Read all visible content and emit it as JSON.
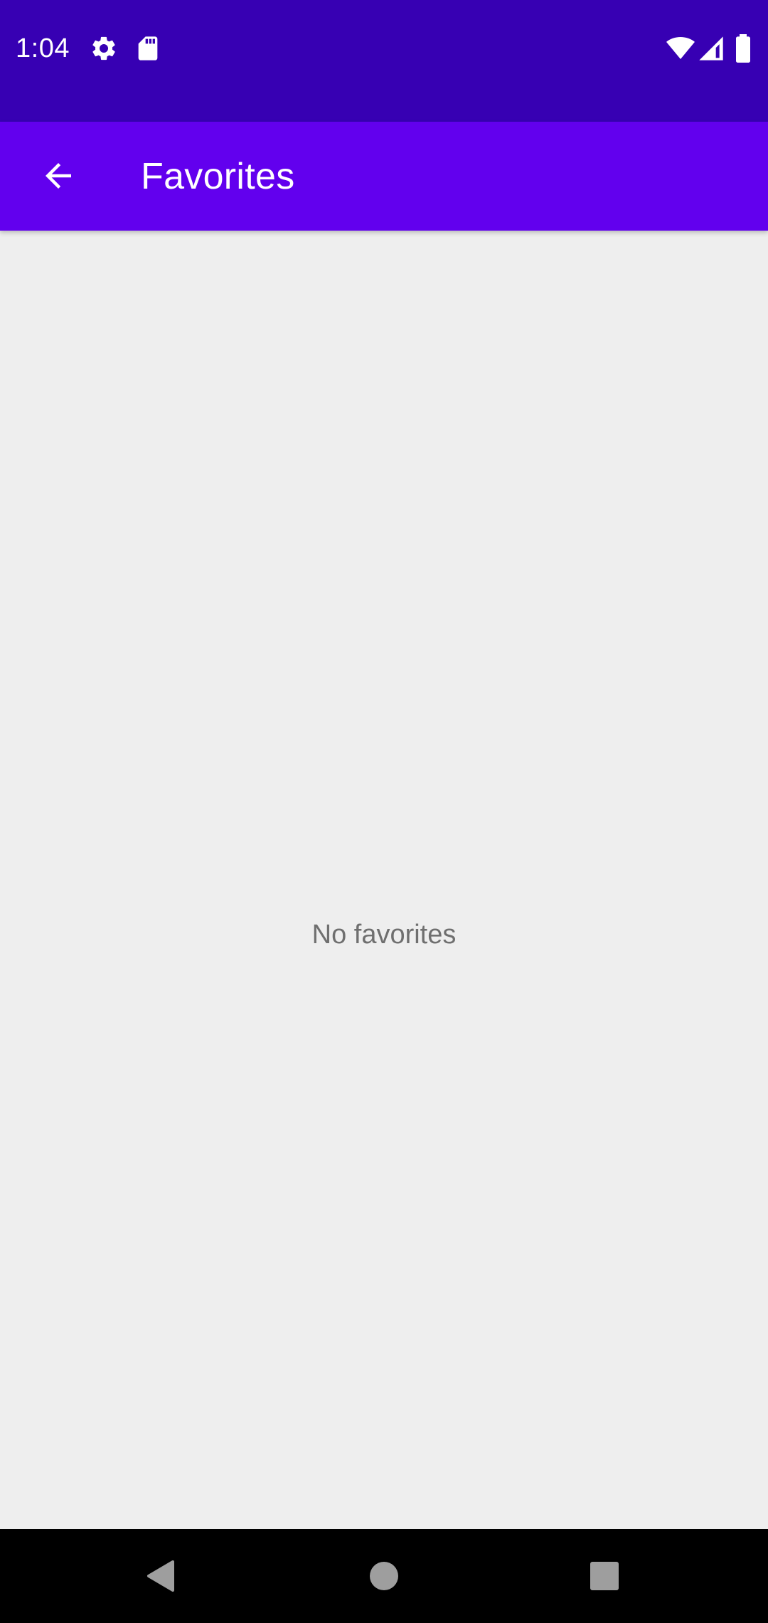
{
  "status_bar": {
    "time": "1:04",
    "icons_left": [
      "gear-icon",
      "sd-card-icon"
    ],
    "icons_right": [
      "wifi-icon",
      "cell-signal-icon",
      "battery-icon"
    ],
    "background": "#3700b3"
  },
  "app_bar": {
    "back_icon": "arrow-back-icon",
    "title": "Favorites",
    "background": "#6200ee"
  },
  "content": {
    "empty_message": "No favorites",
    "background": "#eeeeee"
  },
  "nav_bar": {
    "buttons": [
      "back-triangle-icon",
      "home-circle-icon",
      "recents-square-icon"
    ],
    "background": "#000000"
  }
}
